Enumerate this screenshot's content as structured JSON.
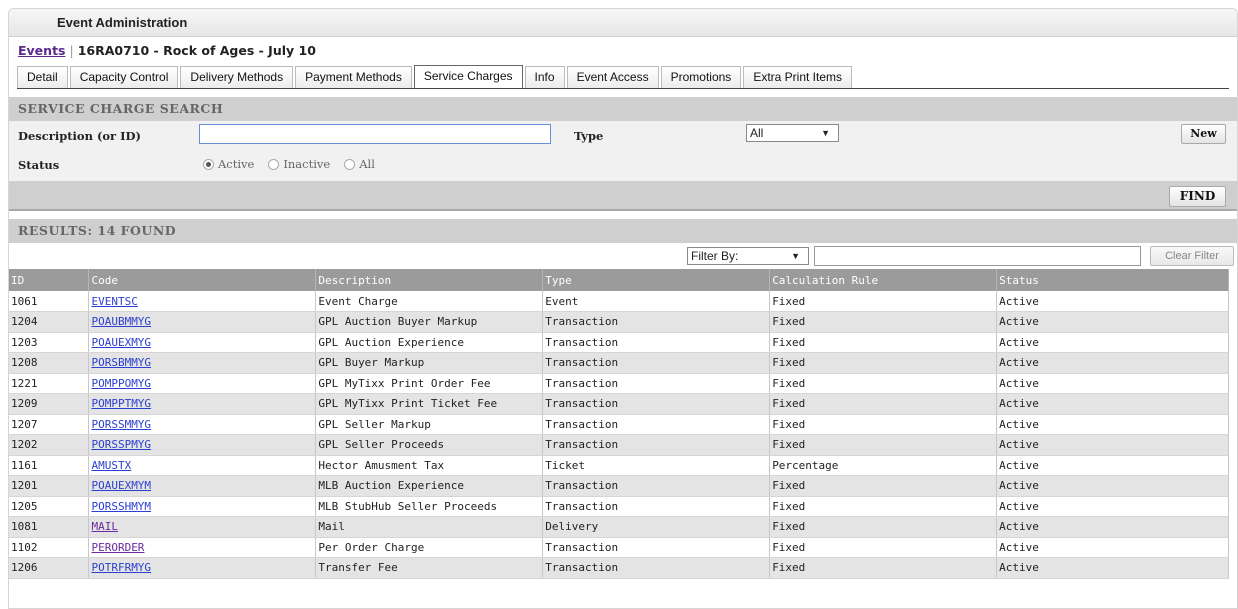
{
  "app": {
    "title": "Event Administration"
  },
  "breadcrumb": {
    "link": "Events",
    "separator": "|",
    "current": "16RA0710 - Rock of Ages - July 10"
  },
  "tabs": [
    {
      "label": "Detail"
    },
    {
      "label": "Capacity Control"
    },
    {
      "label": "Delivery Methods"
    },
    {
      "label": "Payment Methods"
    },
    {
      "label": "Service Charges",
      "active": true
    },
    {
      "label": "Info"
    },
    {
      "label": "Event Access"
    },
    {
      "label": "Promotions"
    },
    {
      "label": "Extra Print Items"
    }
  ],
  "search": {
    "title": "SERVICE CHARGE SEARCH",
    "description_label": "Description (or ID)",
    "description_value": "",
    "type_label": "Type",
    "type_value": "All",
    "new_button": "New",
    "status_label": "Status",
    "status_options": [
      "Active",
      "Inactive",
      "All"
    ],
    "status_selected": "Active",
    "find_button": "FIND"
  },
  "results": {
    "title": "RESULTS: 14 FOUND",
    "filter_by_value": "Filter By:",
    "filter_value": "",
    "clear_filter_button": "Clear Filter",
    "columns": [
      "ID",
      "Code",
      "Description",
      "Type",
      "Calculation Rule",
      "Status"
    ],
    "rows": [
      [
        "1061",
        "EVENTSC",
        "Event Charge",
        "Event",
        "Fixed",
        "Active"
      ],
      [
        "1204",
        "POAUBMMYG",
        "GPL Auction Buyer Markup",
        "Transaction",
        "Fixed",
        "Active"
      ],
      [
        "1203",
        "POAUEXMYG",
        "GPL Auction Experience",
        "Transaction",
        "Fixed",
        "Active"
      ],
      [
        "1208",
        "PORSBMMYG",
        "GPL Buyer Markup",
        "Transaction",
        "Fixed",
        "Active"
      ],
      [
        "1221",
        "POMPPOMYG",
        "GPL MyTixx Print Order Fee",
        "Transaction",
        "Fixed",
        "Active"
      ],
      [
        "1209",
        "POMPPTMYG",
        "GPL MyTixx Print Ticket Fee",
        "Transaction",
        "Fixed",
        "Active"
      ],
      [
        "1207",
        "PORSSMMYG",
        "GPL Seller Markup",
        "Transaction",
        "Fixed",
        "Active"
      ],
      [
        "1202",
        "PORSSPMYG",
        "GPL Seller Proceeds",
        "Transaction",
        "Fixed",
        "Active"
      ],
      [
        "1161",
        "AMUSTX",
        "Hector Amusment Tax",
        "Ticket",
        "Percentage",
        "Active"
      ],
      [
        "1201",
        "POAUEXMYM",
        "MLB Auction Experience",
        "Transaction",
        "Fixed",
        "Active"
      ],
      [
        "1205",
        "PORSSHMYM",
        "MLB StubHub Seller Proceeds",
        "Transaction",
        "Fixed",
        "Active"
      ],
      [
        "1081",
        "MAIL",
        "Mail",
        "Delivery",
        "Fixed",
        "Active"
      ],
      [
        "1102",
        "PERORDER",
        "Per Order Charge",
        "Transaction",
        "Fixed",
        "Active"
      ],
      [
        "1206",
        "POTRFRMYG",
        "Transfer Fee",
        "Transaction",
        "Fixed",
        "Active"
      ]
    ],
    "visited_codes": [
      "MAIL",
      "PERORDER"
    ]
  }
}
